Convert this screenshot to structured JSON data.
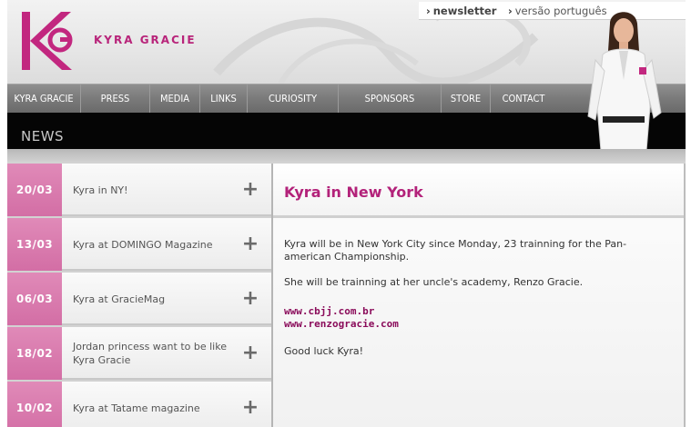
{
  "brand": {
    "name": "KYRA GRACIE"
  },
  "toplinks": {
    "newsletter": "newsletter",
    "language": "versão português"
  },
  "nav": {
    "items": [
      "KYRA GRACIE",
      "PRESS",
      "MEDIA",
      "LINKS",
      "CURIOSITY",
      "SPONSORS",
      "STORE",
      "CONTACT"
    ]
  },
  "section": {
    "title": "NEWS"
  },
  "news": [
    {
      "date": "20/03",
      "title": "Kyra in NY!"
    },
    {
      "date": "13/03",
      "title": "Kyra at DOMINGO Magazine"
    },
    {
      "date": "06/03",
      "title": "Kyra at GracieMag"
    },
    {
      "date": "18/02",
      "title": "Jordan princess want to be like Kyra Gracie"
    },
    {
      "date": "10/02",
      "title": "Kyra at Tatame magazine"
    }
  ],
  "expand_symbol": "+",
  "article": {
    "title": "Kyra in New York",
    "p1": "Kyra will be in New York City since Monday, 23 trainning for the Pan-american Championship.",
    "p2": "She will be trainning at her uncle's academy, Renzo Gracie.",
    "link1": "www.cbjj.com.br",
    "link2": "www.renzogracie.com",
    "p3": "Good luck Kyra!"
  },
  "colors": {
    "accent": "#b8247a",
    "date_bg": "#d878ad",
    "nav_bg": "#7a7a7a"
  },
  "icons": {
    "expand": "plus-icon",
    "toplink_arrow": "chevron-right-icon"
  }
}
